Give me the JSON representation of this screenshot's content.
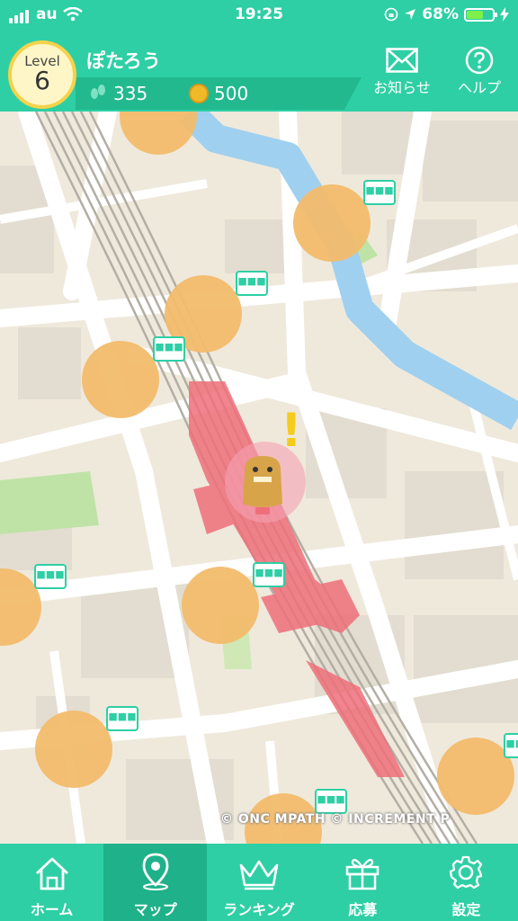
{
  "status_bar": {
    "carrier": "au",
    "time": "19:25",
    "battery": "68%",
    "battery_level": 0.68
  },
  "header": {
    "level_label": "Level",
    "level_value": "6",
    "username": "ぽたろう",
    "steps": "335",
    "coins": "500",
    "notice_label": "お知らせ",
    "help_label": "ヘルプ"
  },
  "map": {
    "copyright": "© ONC  MPATH © INCREMENT P",
    "bubble_text": "■■■",
    "alert_mark": "!"
  },
  "tabs": [
    {
      "label": "ホーム",
      "icon": "home-icon"
    },
    {
      "label": "マップ",
      "icon": "map-pin-icon",
      "active": true
    },
    {
      "label": "ランキング",
      "icon": "crown-icon"
    },
    {
      "label": "応募",
      "icon": "gift-icon"
    },
    {
      "label": "設定",
      "icon": "gear-icon"
    }
  ],
  "colors": {
    "accent": "#2ecfa5",
    "accent_dark": "#1fb189",
    "avatar_bg": "#f2bc6c",
    "station": "#ee6f7a",
    "river": "#9fd0ef"
  }
}
